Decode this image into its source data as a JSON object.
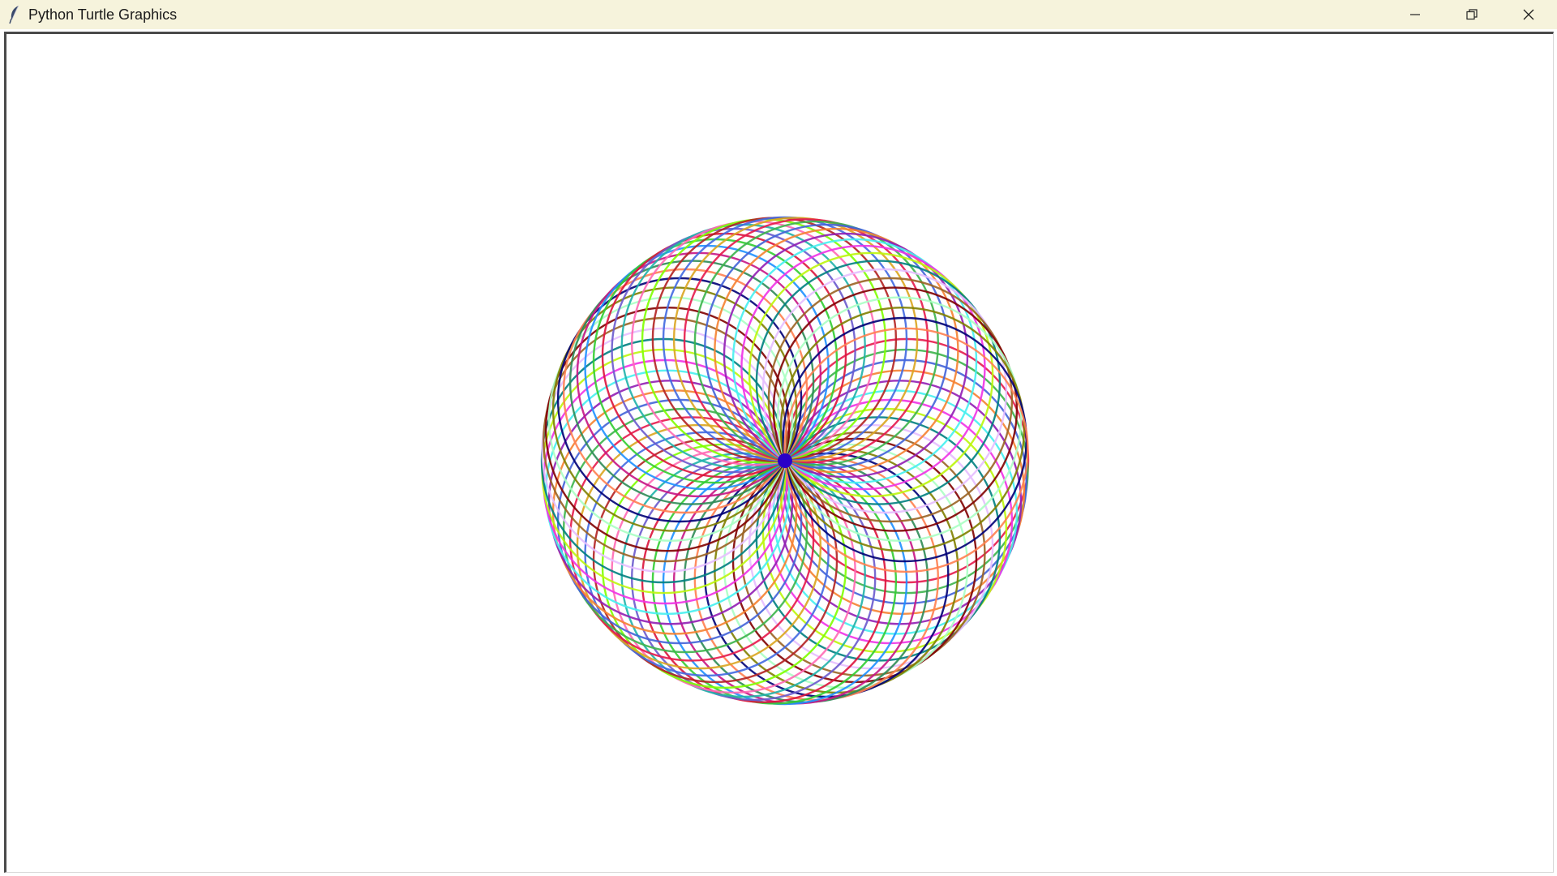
{
  "window": {
    "title": "Python Turtle Graphics",
    "app_icon": "feather-icon",
    "controls": {
      "minimize_icon": "minimize-icon",
      "maximize_icon": "restore-icon",
      "close_icon": "close-icon"
    }
  },
  "canvas": {
    "background": "#ffffff",
    "drawing": {
      "shape": "spirograph",
      "turtle_color": "#2a00c8",
      "palette": [
        "#e6194b",
        "#3cb44b",
        "#4363d8",
        "#f58231",
        "#911eb4",
        "#46f0f0",
        "#f032e6",
        "#bcf60c",
        "#008080",
        "#e6beff",
        "#9a6324",
        "#800000",
        "#aaffc3",
        "#808000",
        "#000075",
        "#ff7f50",
        "#2e8b57",
        "#c71585",
        "#1e90ff",
        "#32cd32",
        "#dc143c",
        "#6a5acd",
        "#20b2aa",
        "#ff69b4",
        "#7fff00",
        "#b22222",
        "#4169e1",
        "#daa520"
      ]
    }
  }
}
